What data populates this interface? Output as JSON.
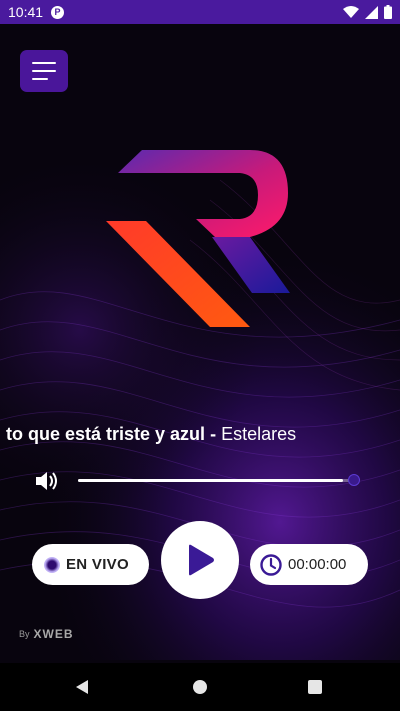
{
  "status_bar": {
    "time": "10:41",
    "app_icon": "p-badge-icon",
    "icons": [
      "wifi-icon",
      "signal-icon",
      "battery-icon"
    ]
  },
  "header": {
    "menu_icon": "hamburger-menu-icon"
  },
  "logo": {
    "letter": "R",
    "colors": {
      "top": "#ff1a6a",
      "mid": "#7a2bb8",
      "bottom": "#ff4a1a",
      "shadow": "#2a1a9a"
    }
  },
  "player": {
    "track": "to que está triste y azul",
    "separator": "-",
    "artist": "Estelares",
    "volume_level": 0.96,
    "live_label": "EN VIVO",
    "timer": "00:00:00",
    "play_icon": "play-icon",
    "timer_icon": "clock-icon",
    "volume_icon": "speaker-icon"
  },
  "credit": {
    "by": "By",
    "brand": "XWEB"
  },
  "nav": {
    "back": "back-icon",
    "home": "home-icon",
    "recents": "recents-icon"
  },
  "colors": {
    "accent": "#4a169a",
    "status_bar": "#4a1a9e",
    "play_triangle": "#3a1a96"
  }
}
